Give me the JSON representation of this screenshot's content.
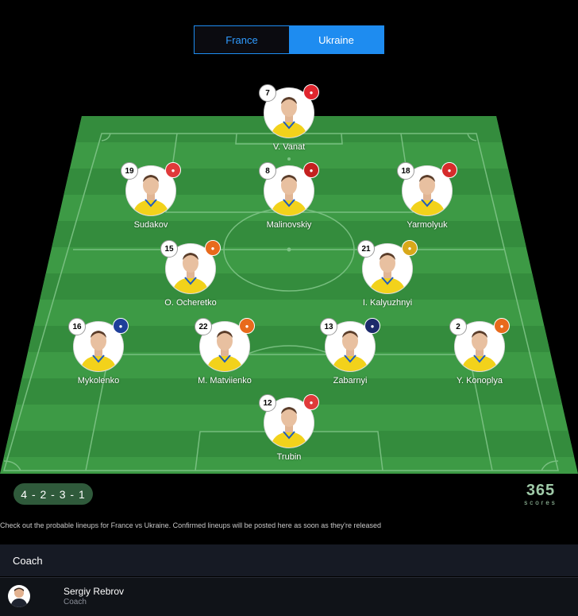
{
  "tabs": {
    "home": "France",
    "away": "Ukraine",
    "active": "Ukraine"
  },
  "players": [
    {
      "key": "gk",
      "number": "12",
      "name": "Trubin",
      "club_color": "#e03a3a",
      "club_icon": "benfica-icon"
    },
    {
      "key": "lb",
      "number": "16",
      "name": "Mykolenko",
      "club_color": "#1f3f9a",
      "club_icon": "everton-icon"
    },
    {
      "key": "lcb",
      "number": "22",
      "name": "M. Matviienko",
      "club_color": "#e86a1c",
      "club_icon": "shakhtar-icon"
    },
    {
      "key": "rcb",
      "number": "13",
      "name": "Zabarnyi",
      "club_color": "#1c2a6b",
      "club_icon": "psg-icon"
    },
    {
      "key": "rb",
      "number": "2",
      "name": "Y. Konoplya",
      "club_color": "#e86a1c",
      "club_icon": "shakhtar-icon"
    },
    {
      "key": "lm",
      "number": "15",
      "name": "O. Ocheretko",
      "club_color": "#e86a1c",
      "club_icon": "shakhtar-icon"
    },
    {
      "key": "rm",
      "number": "21",
      "name": "I. Kalyuzhnyi",
      "club_color": "#d8a81a",
      "club_icon": "metalist-icon"
    },
    {
      "key": "law",
      "number": "19",
      "name": "Sudakov",
      "club_color": "#e03a3a",
      "club_icon": "benfica-icon"
    },
    {
      "key": "cam",
      "number": "8",
      "name": "Malinovskiy",
      "club_color": "#c4201f",
      "club_icon": "genoa-icon"
    },
    {
      "key": "raw",
      "number": "18",
      "name": "Yarmolyuk",
      "club_color": "#d62b2b",
      "club_icon": "brentford-icon"
    },
    {
      "key": "st",
      "number": "7",
      "name": "V. Vanat",
      "club_color": "#e0262e",
      "club_icon": "girona-icon"
    }
  ],
  "formation": "4 - 2 - 3 - 1",
  "brand": {
    "logo_text": "365",
    "logo_sub": "scores"
  },
  "note": "Check out the probable lineups for France vs Ukraine. Confirmed lineups will be posted here as soon as they're released",
  "coach": {
    "section_title": "Coach",
    "name": "Sergiy Rebrov",
    "role": "Coach"
  },
  "colors": {
    "accent": "#1e8cf0",
    "pitch_light": "#3d9a45",
    "pitch_dark": "#348c3d",
    "jersey": "#f2d21b"
  }
}
